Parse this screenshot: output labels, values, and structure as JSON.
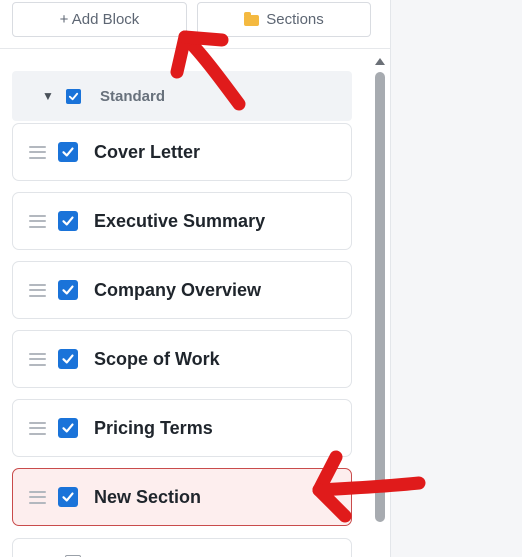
{
  "toolbar": {
    "add_block_label": "+ Add Block",
    "sections_label": "Sections"
  },
  "group": {
    "label": "Standard",
    "checked": true,
    "expanded": true
  },
  "items": [
    {
      "label": "Cover Letter",
      "checked": true
    },
    {
      "label": "Executive Summary",
      "checked": true
    },
    {
      "label": "Company Overview",
      "checked": true
    },
    {
      "label": "Scope of Work",
      "checked": true
    },
    {
      "label": "Pricing Terms",
      "checked": true
    },
    {
      "label": "New Section",
      "checked": true,
      "highlighted": true
    }
  ],
  "colors": {
    "checkbox": "#1a73d9",
    "highlight_bg": "#fdeeee",
    "highlight_border": "#c94b4b",
    "annotation_arrow": "#e01b1b"
  },
  "icons": {
    "sections": "folder-icon",
    "drag": "drag-handle-icon",
    "expand": "caret-down-icon"
  }
}
